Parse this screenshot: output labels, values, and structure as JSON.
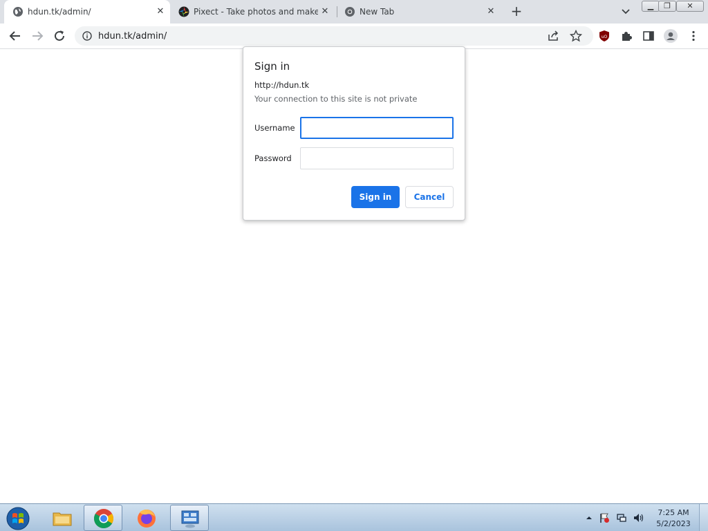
{
  "tabs": [
    {
      "title": "hdun.tk/admin/",
      "active": true,
      "icon": "globe-icon"
    },
    {
      "title": "Pixect - Take photos and make vi",
      "active": false,
      "icon": "pixect-icon"
    },
    {
      "title": "New Tab",
      "active": false,
      "icon": "chrome-icon"
    }
  ],
  "toolbar": {
    "url": "hdun.tk/admin/"
  },
  "dialog": {
    "title": "Sign in",
    "host": "http://hdun.tk",
    "note": "Your connection to this site is not private",
    "username_label": "Username",
    "password_label": "Password",
    "username_value": "",
    "password_value": "",
    "signin_label": "Sign in",
    "cancel_label": "Cancel"
  },
  "taskbar": {
    "time": "7:25 AM",
    "date": "5/2/2023",
    "items": [
      "start-orb",
      "file-explorer",
      "chrome",
      "firefox",
      "control-panel"
    ]
  },
  "colors": {
    "accent": "#1a73e8",
    "tabstrip": "#dee1e6",
    "omnibox": "#f1f3f4"
  }
}
